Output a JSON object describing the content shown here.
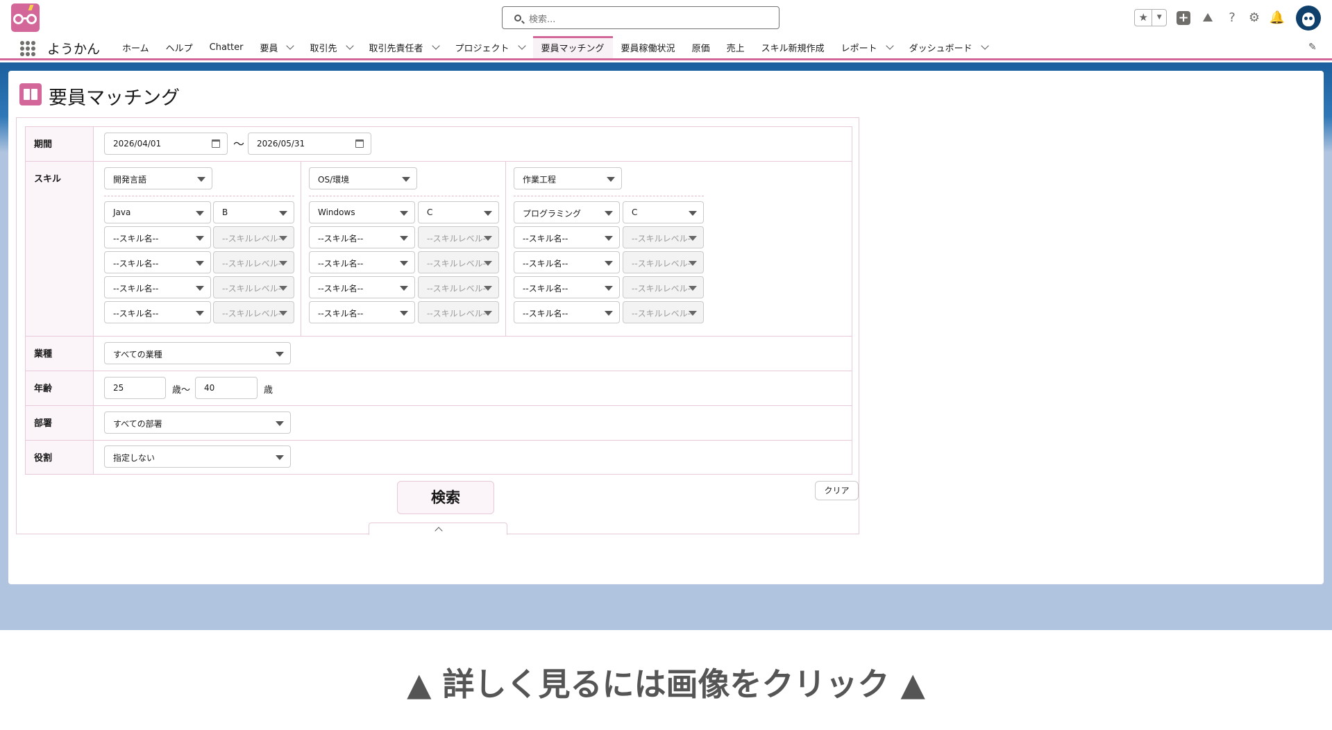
{
  "header": {
    "search_placeholder": "検索..."
  },
  "nav": {
    "app_name": "ようかん",
    "items": [
      {
        "label": "ホーム",
        "dropdown": false
      },
      {
        "label": "ヘルプ",
        "dropdown": false
      },
      {
        "label": "Chatter",
        "dropdown": false
      },
      {
        "label": "要員",
        "dropdown": true
      },
      {
        "label": "取引先",
        "dropdown": true
      },
      {
        "label": "取引先責任者",
        "dropdown": true
      },
      {
        "label": "プロジェクト",
        "dropdown": true
      },
      {
        "label": "要員マッチング",
        "dropdown": false,
        "active": true
      },
      {
        "label": "要員稼働状況",
        "dropdown": false
      },
      {
        "label": "原価",
        "dropdown": false
      },
      {
        "label": "売上",
        "dropdown": false
      },
      {
        "label": "スキル新規作成",
        "dropdown": false
      },
      {
        "label": "レポート",
        "dropdown": true
      },
      {
        "label": "ダッシュボード",
        "dropdown": true
      }
    ]
  },
  "page": {
    "title": "要員マッチング"
  },
  "form": {
    "period": {
      "label": "期間",
      "from": "2026/04/01",
      "separator": "〜",
      "to": "2026/05/31"
    },
    "skill": {
      "label": "スキル",
      "categories": [
        {
          "category": "開発言語",
          "rows": [
            {
              "name": "Java",
              "level": "B",
              "level_disabled": false
            },
            {
              "name": "--スキル名--",
              "level": "--スキルレベル--",
              "level_disabled": true
            },
            {
              "name": "--スキル名--",
              "level": "--スキルレベル--",
              "level_disabled": true
            },
            {
              "name": "--スキル名--",
              "level": "--スキルレベル--",
              "level_disabled": true
            },
            {
              "name": "--スキル名--",
              "level": "--スキルレベル--",
              "level_disabled": true
            }
          ]
        },
        {
          "category": "OS/環境",
          "rows": [
            {
              "name": "Windows",
              "level": "C",
              "level_disabled": false
            },
            {
              "name": "--スキル名--",
              "level": "--スキルレベル--",
              "level_disabled": true
            },
            {
              "name": "--スキル名--",
              "level": "--スキルレベル--",
              "level_disabled": true
            },
            {
              "name": "--スキル名--",
              "level": "--スキルレベル--",
              "level_disabled": true
            },
            {
              "name": "--スキル名--",
              "level": "--スキルレベル--",
              "level_disabled": true
            }
          ]
        },
        {
          "category": "作業工程",
          "rows": [
            {
              "name": "プログラミング",
              "level": "C",
              "level_disabled": false
            },
            {
              "name": "--スキル名--",
              "level": "--スキルレベル--",
              "level_disabled": true
            },
            {
              "name": "--スキル名--",
              "level": "--スキルレベル--",
              "level_disabled": true
            },
            {
              "name": "--スキル名--",
              "level": "--スキルレベル--",
              "level_disabled": true
            },
            {
              "name": "--スキル名--",
              "level": "--スキルレベル--",
              "level_disabled": true
            }
          ]
        }
      ]
    },
    "industry": {
      "label": "業種",
      "value": "すべての業種"
    },
    "age": {
      "label": "年齢",
      "min": "25",
      "mid_unit": "歳〜",
      "max": "40",
      "unit": "歳"
    },
    "department": {
      "label": "部署",
      "value": "すべての部署"
    },
    "role": {
      "label": "役割",
      "value": "指定しない"
    },
    "search_button": "検索",
    "clear_button": "クリア"
  },
  "caption": "▲ 詳しく見るには画像をクリック ▲",
  "colors": {
    "accent": "#d4679a",
    "label_bg": "#fbf4f8",
    "border": "#e8c9d9",
    "page_bg": "#b0c4df"
  }
}
